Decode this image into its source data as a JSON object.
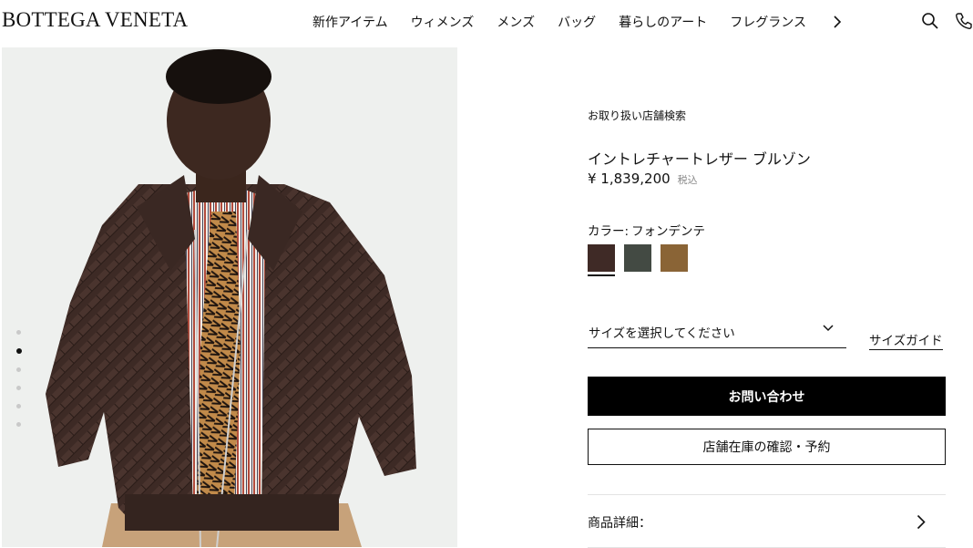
{
  "header": {
    "logo": "BOTTEGA VENETA",
    "nav": [
      "新作アイテム",
      "ウィメンズ",
      "メンズ",
      "バッグ",
      "暮らしのアート",
      "フレグランス"
    ],
    "icons": [
      "chevron-right-icon",
      "search-icon",
      "phone-icon"
    ]
  },
  "gallery": {
    "image_subject": "product-photo-model-in-intrecciato-leather-jacket",
    "slide_count": 6,
    "active_slide": 2
  },
  "product": {
    "store_search": "お取り扱い店舗検索",
    "title": "イントレチャートレザー ブルゾン",
    "price": "¥ 1,839,200",
    "tax_note": "税込",
    "color_label": "カラー:",
    "color_value": "フォンデンテ",
    "swatches": [
      {
        "color": "#3f2a26",
        "selected": true
      },
      {
        "color": "#434a43",
        "selected": false
      },
      {
        "color": "#8a6436",
        "selected": false
      }
    ],
    "size_placeholder": "サイズを選択してください",
    "size_guide": "サイズガイド",
    "contact_button": "お問い合わせ",
    "reserve_button": "店舗在庫の確認・予約",
    "details_label": "商品詳細："
  },
  "colors": {
    "image_bg": "#eef0ee",
    "primary_button": "#000000",
    "text": "#111111"
  }
}
